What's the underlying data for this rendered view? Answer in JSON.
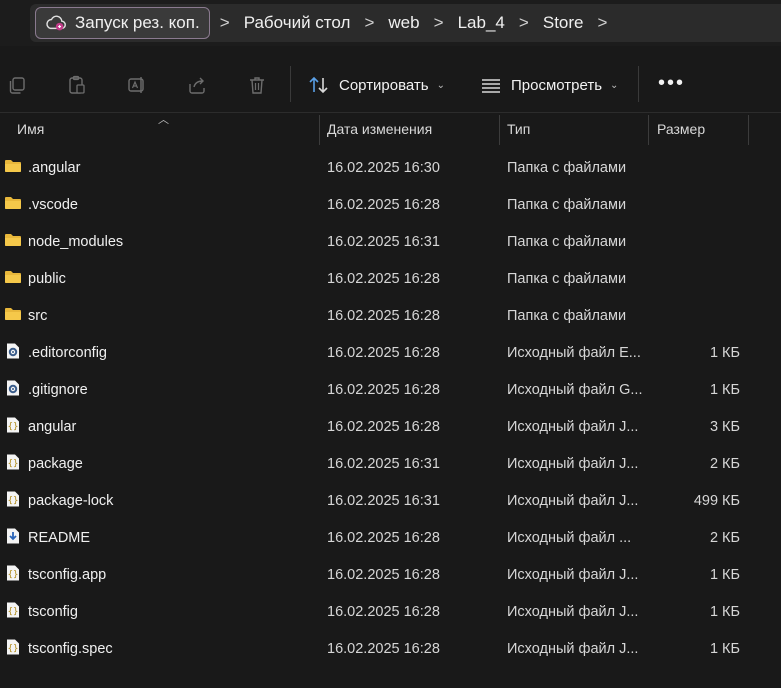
{
  "breadcrumb": {
    "pill_label": "Запуск рез. коп.",
    "items": [
      "Рабочий стол",
      "web",
      "Lab_4",
      "Store"
    ],
    "separator": ">"
  },
  "toolbar": {
    "sort_label": "Сортировать",
    "view_label": "Просмотреть",
    "more_label": "•••",
    "icons": [
      "copy-icon",
      "paste-icon",
      "rename-icon",
      "share-icon",
      "delete-icon",
      "sort-icon",
      "view-icon"
    ]
  },
  "columns": {
    "name": "Имя",
    "date": "Дата изменения",
    "type": "Тип",
    "size": "Размер"
  },
  "files": [
    {
      "name": ".angular",
      "date": "16.02.2025 16:30",
      "type": "Папка с файлами",
      "size": "",
      "icon": "folder-icon"
    },
    {
      "name": ".vscode",
      "date": "16.02.2025 16:28",
      "type": "Папка с файлами",
      "size": "",
      "icon": "folder-icon"
    },
    {
      "name": "node_modules",
      "date": "16.02.2025 16:31",
      "type": "Папка с файлами",
      "size": "",
      "icon": "folder-icon"
    },
    {
      "name": "public",
      "date": "16.02.2025 16:28",
      "type": "Папка с файлами",
      "size": "",
      "icon": "folder-icon"
    },
    {
      "name": "src",
      "date": "16.02.2025 16:28",
      "type": "Папка с файлами",
      "size": "",
      "icon": "folder-icon"
    },
    {
      "name": ".editorconfig",
      "date": "16.02.2025 16:28",
      "type": "Исходный файл E...",
      "size": "1 КБ",
      "icon": "config-file-icon"
    },
    {
      "name": ".gitignore",
      "date": "16.02.2025 16:28",
      "type": "Исходный файл G...",
      "size": "1 КБ",
      "icon": "config-file-icon"
    },
    {
      "name": "angular",
      "date": "16.02.2025 16:28",
      "type": "Исходный файл J...",
      "size": "3 КБ",
      "icon": "json-file-icon"
    },
    {
      "name": "package",
      "date": "16.02.2025 16:31",
      "type": "Исходный файл J...",
      "size": "2 КБ",
      "icon": "json-file-icon"
    },
    {
      "name": "package-lock",
      "date": "16.02.2025 16:31",
      "type": "Исходный файл J...",
      "size": "499 КБ",
      "icon": "json-file-icon"
    },
    {
      "name": "README",
      "date": "16.02.2025 16:28",
      "type": "Исходный файл ...",
      "size": "2 КБ",
      "icon": "markdown-file-icon"
    },
    {
      "name": "tsconfig.app",
      "date": "16.02.2025 16:28",
      "type": "Исходный файл J...",
      "size": "1 КБ",
      "icon": "json-file-icon"
    },
    {
      "name": "tsconfig",
      "date": "16.02.2025 16:28",
      "type": "Исходный файл J...",
      "size": "1 КБ",
      "icon": "json-file-icon"
    },
    {
      "name": "tsconfig.spec",
      "date": "16.02.2025 16:28",
      "type": "Исходный файл J...",
      "size": "1 КБ",
      "icon": "json-file-icon"
    }
  ],
  "colors": {
    "background": "#191919",
    "folder": "#e8b73b",
    "pill_border": "#8a7a8f"
  }
}
